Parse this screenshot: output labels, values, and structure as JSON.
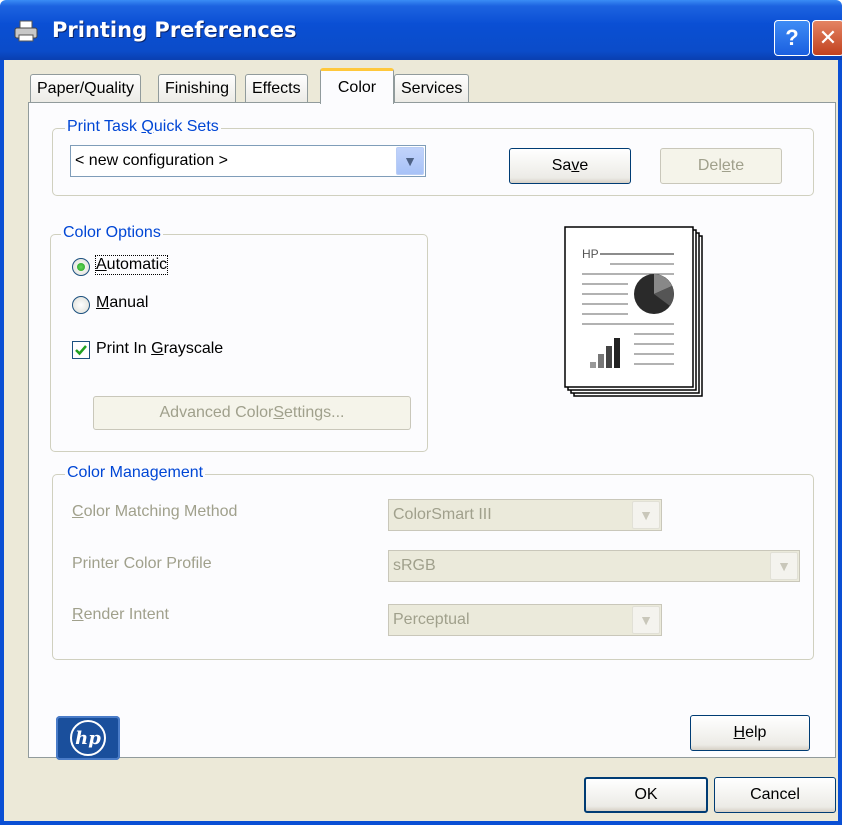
{
  "window": {
    "title": "Printing Preferences",
    "help_glyph": "?",
    "close_glyph": "✕"
  },
  "tabs": [
    {
      "label": "Paper/Quality",
      "active": false
    },
    {
      "label": "Finishing",
      "active": false
    },
    {
      "label": "Effects",
      "active": false
    },
    {
      "label": "Color",
      "active": true
    },
    {
      "label": "Services",
      "active": false
    }
  ],
  "quick_sets": {
    "group_label_pre": "Print Task ",
    "group_label_key": "Q",
    "group_label_post": "uick Sets",
    "selected": "< new configuration >",
    "save_pre": "Sa",
    "save_key": "v",
    "save_post": "e",
    "delete_pre": "Del",
    "delete_key": "e",
    "delete_post": "te"
  },
  "color_options": {
    "group_label": "Color Options",
    "automatic_key": "A",
    "automatic_rest": "utomatic",
    "automatic_selected": true,
    "manual_key": "M",
    "manual_rest": "anual",
    "grayscale_pre": "Print In ",
    "grayscale_key": "G",
    "grayscale_post": "rayscale",
    "grayscale_checked": true,
    "advanced_pre": "Advanced Color ",
    "advanced_key": "S",
    "advanced_post": "ettings..."
  },
  "preview": {
    "brand_text": "HP"
  },
  "color_management": {
    "group_label": "Color Management",
    "matching_key": "C",
    "matching_rest": "olor Matching Method",
    "matching_value": "ColorSmart III",
    "profile_label": "Printer Color Profile",
    "profile_value": "sRGB",
    "render_key": "R",
    "render_rest": "ender Intent",
    "render_value": "Perceptual"
  },
  "footer": {
    "logo_text": "hp",
    "help_key": "H",
    "help_rest": "elp",
    "ok": "OK",
    "cancel": "Cancel"
  },
  "colors": {
    "title_bar": "#0a4fd4",
    "dialog_bg": "#ece9d8",
    "group_label": "#0046d5",
    "hp_logo": "#1a4f9c",
    "tab_highlight": "#ffc83c"
  }
}
